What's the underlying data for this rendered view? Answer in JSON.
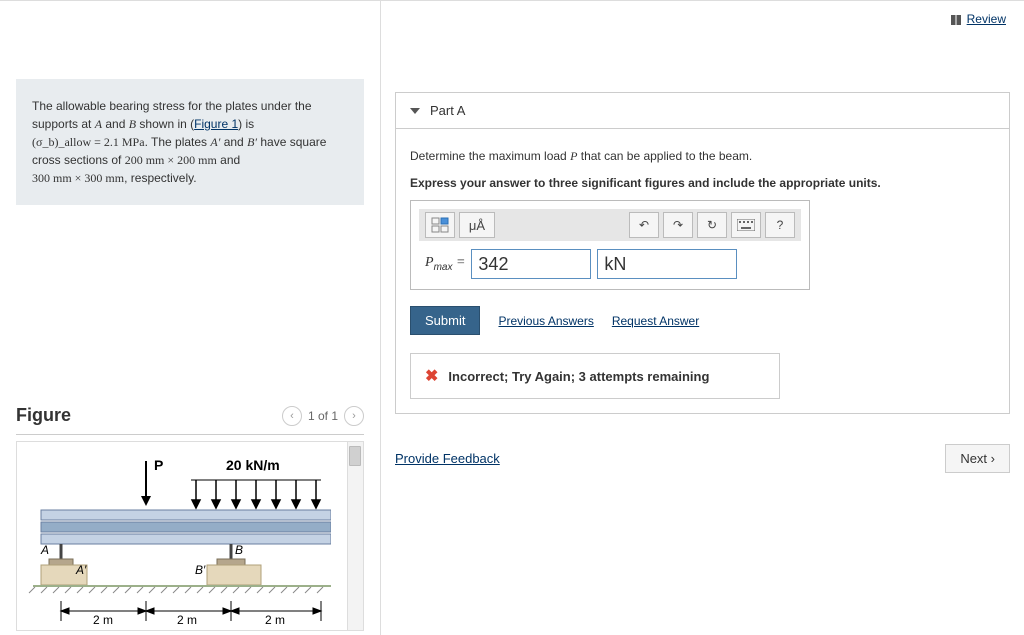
{
  "review_label": "Review",
  "problem": {
    "line1a": "The allowable bearing stress for the plates under the supports at ",
    "A": "A",
    "line1b": " and ",
    "B": "B",
    "line1c": " shown in (",
    "figlink": "Figure 1",
    "line1d": ") is ",
    "sigma": "(σ_b)_allow = 2.1 MPa",
    "line2a": ". The plates ",
    "Aprime": "A′",
    "line2b": " and ",
    "Bprime": "B′",
    "line2c": " have square cross sections of ",
    "size1": "200 mm × 200 mm",
    "line2d": " and ",
    "size2": "300 mm × 300 mm",
    "line2e": ", respectively."
  },
  "figure": {
    "title": "Figure",
    "counter": "1 of 1",
    "load_label": "P",
    "dist_label": "20 kN/m",
    "A": "A",
    "B": "B",
    "Aprime": "A′",
    "Bprime": "B′",
    "dim": "2 m"
  },
  "partA": {
    "title": "Part A",
    "question": "Determine the maximum load P that can be applied to the beam.",
    "instruction": "Express your answer to three significant figures and include the appropriate units.",
    "pmax_label": "P_max =",
    "value": "342",
    "units": "kN",
    "submit": "Submit",
    "prev_answers": "Previous Answers",
    "request_answer": "Request Answer",
    "feedback": "Incorrect; Try Again; 3 attempts remaining",
    "toolbar_mu": "μÅ",
    "toolbar_q": "?"
  },
  "provide_feedback": "Provide Feedback",
  "next": "Next"
}
